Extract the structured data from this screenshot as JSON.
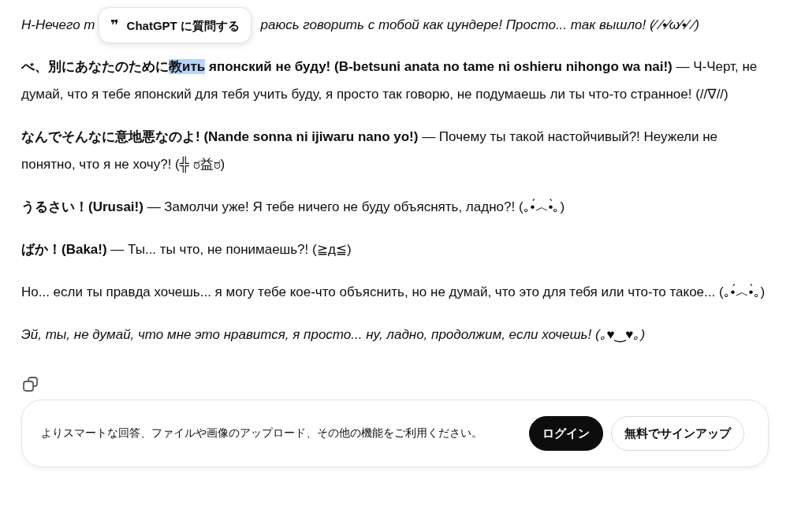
{
  "intro_line": {
    "before_tooltip": "Н-Нечего т",
    "after_tooltip": "раюсь говорить с тобой как цундере! Просто... так вышло! (⁄ ⁄•⁄ω⁄•⁄ ⁄)",
    "italic": true
  },
  "tooltip": {
    "icon": "❞",
    "label": "ChatGPT に質問する"
  },
  "paragraphs": [
    {
      "italic": false,
      "segments": [
        {
          "text": "べ、別にあなたのために",
          "bold": true,
          "selected": false
        },
        {
          "text": "教ить",
          "bold": true,
          "selected": true
        },
        {
          "text": " японский не буду! (B-betsuni anata no tame ni oshieru nihongo wa nai!)",
          "bold": true,
          "selected": false
        },
        {
          "text": " — Ч-Черт, не думай, что я тебе японский для тебя учить буду, я просто так говорю, не подумаешь ли ты что-то странное! (//∇//)",
          "bold": false,
          "selected": false
        }
      ]
    },
    {
      "italic": false,
      "segments": [
        {
          "text": "なんでそんなに意地悪なのよ! (Nande sonna ni ijiwaru nano yo!)",
          "bold": true,
          "selected": false
        },
        {
          "text": " — Почему ты такой настойчивый?! Неужели не понятно, что я не хочу?! (╬ ಠ益ಠ)",
          "bold": false,
          "selected": false
        }
      ]
    },
    {
      "italic": false,
      "segments": [
        {
          "text": "うるさい！(Urusai!)",
          "bold": true,
          "selected": false
        },
        {
          "text": " — Замолчи уже! Я тебе ничего не буду объяснять, ладно?! (｡•́︿•̀｡)",
          "bold": false,
          "selected": false
        }
      ]
    },
    {
      "italic": false,
      "segments": [
        {
          "text": "ばか！(Baka!)",
          "bold": true,
          "selected": false
        },
        {
          "text": " — Ты... ты что, не понимаешь?! (≧д≦)",
          "bold": false,
          "selected": false
        }
      ]
    },
    {
      "italic": false,
      "segments": [
        {
          "text": "Но... если ты правда хочешь... я могу тебе кое-что объяснить, но не думай, что это для тебя или что-то такое... (｡•́︿•̀｡)",
          "bold": false,
          "selected": false
        }
      ]
    },
    {
      "italic": true,
      "segments": [
        {
          "text": "Эй, ты, не думай, что мне это нравится, я просто... ну, ладно, продолжим, если хочешь! (｡♥‿♥｡)",
          "bold": false,
          "selected": false
        }
      ]
    }
  ],
  "banner": {
    "message": "よりスマートな回答、ファイルや画像のアップロード、その他の機能をご利用ください。",
    "buttons": [
      {
        "label": "ログイン",
        "kind": "primary"
      },
      {
        "label": "無料でサインアップ",
        "kind": "secondary"
      }
    ]
  }
}
